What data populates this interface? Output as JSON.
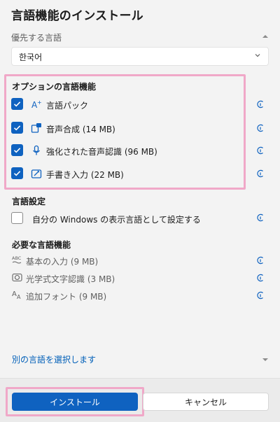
{
  "dialog": {
    "title": "言語機能のインストール",
    "preferred_language_label": "優先する言語",
    "selected_language": "한국어"
  },
  "optional_features": {
    "heading": "オプションの言語機能",
    "items": [
      {
        "label": "言語パック",
        "checked": true
      },
      {
        "label": "音声合成 (14 MB)",
        "checked": true
      },
      {
        "label": "強化された音声認識 (96 MB)",
        "checked": true
      },
      {
        "label": "手書き入力 (22 MB)",
        "checked": true
      }
    ]
  },
  "language_settings": {
    "heading": "言語設定",
    "display_language_option": "自分の Windows の表示言語として設定する",
    "checked": false
  },
  "required_features": {
    "heading": "必要な言語機能",
    "items": [
      {
        "label": "基本の入力 (9 MB)"
      },
      {
        "label": "光学式文字認識 (3 MB)"
      },
      {
        "label": "追加フォント (9 MB)"
      }
    ]
  },
  "choose_other_language_link": "別の言語を選択します",
  "buttons": {
    "install": "インストール",
    "cancel": "キャンセル"
  },
  "colors": {
    "accent": "#0f62c0",
    "highlight": "#f0a8c8"
  }
}
